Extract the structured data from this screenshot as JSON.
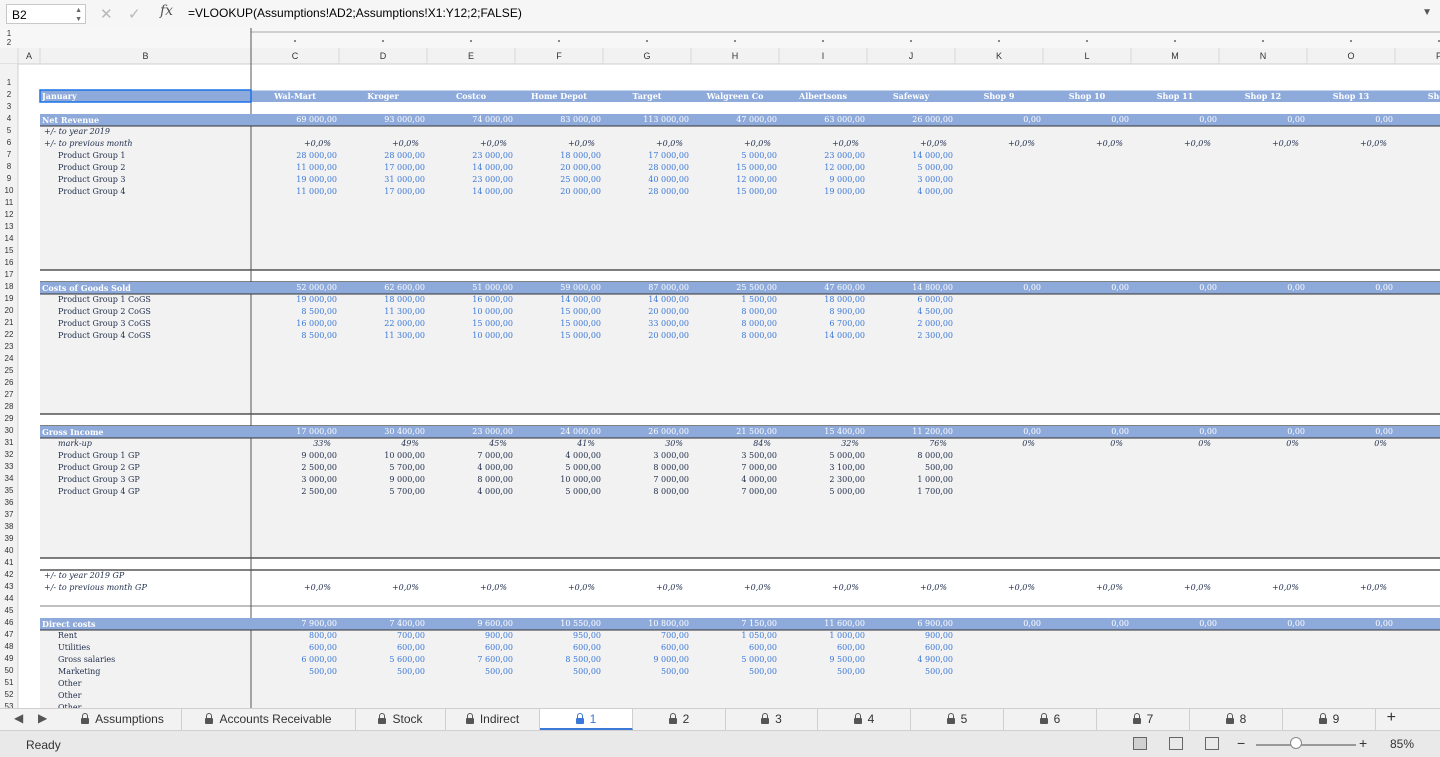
{
  "formula_bar": {
    "name_box": "B2",
    "fx": "fx",
    "formula": "=VLOOKUP(Assumptions!AD2;Assumptions!X1:Y12;2;FALSE)"
  },
  "outline_levels": [
    "1",
    "2"
  ],
  "columns": [
    "A",
    "B",
    "C",
    "D",
    "E",
    "F",
    "G",
    "H",
    "I",
    "J",
    "K",
    "L",
    "M",
    "N",
    "O",
    "P"
  ],
  "row_numbers": [
    "1",
    "2",
    "3",
    "4",
    "5",
    "6",
    "7",
    "8",
    "9",
    "10",
    "11",
    "12",
    "13",
    "14",
    "15",
    "16",
    "17",
    "18",
    "19",
    "20",
    "21",
    "22",
    "23",
    "24",
    "25",
    "26",
    "27",
    "28",
    "29",
    "30",
    "31",
    "32",
    "33",
    "34",
    "35",
    "36",
    "37",
    "38",
    "39",
    "40",
    "41",
    "42",
    "43",
    "44",
    "45",
    "46",
    "47",
    "48",
    "49",
    "50",
    "51",
    "52",
    "53"
  ],
  "header_row": {
    "label": "January",
    "shops": [
      "Wal-Mart",
      "Kroger",
      "Costco",
      "Home Depot",
      "Target",
      "Walgreen Co",
      "Albertsons",
      "Safeway",
      "Shop 9",
      "Shop 10",
      "Shop 11",
      "Shop 12",
      "Shop 13",
      "Shop"
    ]
  },
  "rows": [
    {
      "r": 4,
      "label": "Net Revenue",
      "style": "section",
      "values": [
        "69 000,00",
        "93 000,00",
        "74 000,00",
        "83 000,00",
        "113 000,00",
        "47 000,00",
        "63 000,00",
        "26 000,00",
        "0,00",
        "0,00",
        "0,00",
        "0,00",
        "0,00",
        ""
      ]
    },
    {
      "r": 5,
      "label": "+/- to year 2019",
      "style": "italic",
      "values": []
    },
    {
      "r": 6,
      "label": "+/- to previous month",
      "style": "italic",
      "values": [
        "+0,0%",
        "+0,0%",
        "+0,0%",
        "+0,0%",
        "+0,0%",
        "+0,0%",
        "+0,0%",
        "+0,0%",
        "+0,0%",
        "+0,0%",
        "+0,0%",
        "+0,0%",
        "+0,0%",
        ""
      ]
    },
    {
      "r": 7,
      "label": "Product Group 1",
      "style": "sub",
      "values": [
        "28 000,00",
        "28 000,00",
        "23 000,00",
        "18 000,00",
        "17 000,00",
        "5 000,00",
        "23 000,00",
        "14 000,00"
      ]
    },
    {
      "r": 8,
      "label": "Product Group 2",
      "style": "sub",
      "values": [
        "11 000,00",
        "17 000,00",
        "14 000,00",
        "20 000,00",
        "28 000,00",
        "15 000,00",
        "12 000,00",
        "5 000,00"
      ]
    },
    {
      "r": 9,
      "label": "Product Group 3",
      "style": "sub",
      "values": [
        "19 000,00",
        "31 000,00",
        "23 000,00",
        "25 000,00",
        "40 000,00",
        "12 000,00",
        "9 000,00",
        "3 000,00"
      ]
    },
    {
      "r": 10,
      "label": "Product Group 4",
      "style": "sub",
      "values": [
        "11 000,00",
        "17 000,00",
        "14 000,00",
        "20 000,00",
        "28 000,00",
        "15 000,00",
        "19 000,00",
        "4 000,00"
      ]
    },
    {
      "r": 18,
      "label": "Costs of Goods Sold",
      "style": "section",
      "values": [
        "52 000,00",
        "62 600,00",
        "51 000,00",
        "59 000,00",
        "87 000,00",
        "25 500,00",
        "47 600,00",
        "14 800,00",
        "0,00",
        "0,00",
        "0,00",
        "0,00",
        "0,00",
        ""
      ]
    },
    {
      "r": 19,
      "label": "Product Group 1 CoGS",
      "style": "sub",
      "values": [
        "19 000,00",
        "18 000,00",
        "16 000,00",
        "14 000,00",
        "14 000,00",
        "1 500,00",
        "18 000,00",
        "6 000,00"
      ]
    },
    {
      "r": 20,
      "label": "Product Group 2 CoGS",
      "style": "sub",
      "values": [
        "8 500,00",
        "11 300,00",
        "10 000,00",
        "15 000,00",
        "20 000,00",
        "8 000,00",
        "8 900,00",
        "4 500,00"
      ]
    },
    {
      "r": 21,
      "label": "Product Group 3 CoGS",
      "style": "sub",
      "values": [
        "16 000,00",
        "22 000,00",
        "15 000,00",
        "15 000,00",
        "33 000,00",
        "8 000,00",
        "6 700,00",
        "2 000,00"
      ]
    },
    {
      "r": 22,
      "label": "Product Group 4 CoGS",
      "style": "sub",
      "values": [
        "8 500,00",
        "11 300,00",
        "10 000,00",
        "15 000,00",
        "20 000,00",
        "8 000,00",
        "14 000,00",
        "2 300,00"
      ]
    },
    {
      "r": 30,
      "label": "Gross Income",
      "style": "section",
      "values": [
        "17 000,00",
        "30 400,00",
        "23 000,00",
        "24 000,00",
        "26 000,00",
        "21 500,00",
        "15 400,00",
        "11 200,00",
        "0,00",
        "0,00",
        "0,00",
        "0,00",
        "0,00",
        ""
      ]
    },
    {
      "r": 31,
      "label": "mark-up",
      "style": "markup",
      "values": [
        "33%",
        "49%",
        "45%",
        "41%",
        "30%",
        "84%",
        "32%",
        "76%",
        "0%",
        "0%",
        "0%",
        "0%",
        "0%",
        ""
      ]
    },
    {
      "r": 32,
      "label": "Product Group 1 GP",
      "style": "gp",
      "values": [
        "9 000,00",
        "10 000,00",
        "7 000,00",
        "4 000,00",
        "3 000,00",
        "3 500,00",
        "5 000,00",
        "8 000,00"
      ]
    },
    {
      "r": 33,
      "label": "Product Group 2 GP",
      "style": "gp",
      "values": [
        "2 500,00",
        "5 700,00",
        "4 000,00",
        "5 000,00",
        "8 000,00",
        "7 000,00",
        "3 100,00",
        "500,00"
      ]
    },
    {
      "r": 34,
      "label": "Product Group 3 GP",
      "style": "gp",
      "values": [
        "3 000,00",
        "9 000,00",
        "8 000,00",
        "10 000,00",
        "7 000,00",
        "4 000,00",
        "2 300,00",
        "1 000,00"
      ]
    },
    {
      "r": 35,
      "label": "Product Group 4 GP",
      "style": "gp",
      "values": [
        "2 500,00",
        "5 700,00",
        "4 000,00",
        "5 000,00",
        "8 000,00",
        "7 000,00",
        "5 000,00",
        "1 700,00"
      ]
    },
    {
      "r": 42,
      "label": "+/- to year 2019 GP",
      "style": "italic",
      "values": []
    },
    {
      "r": 43,
      "label": "+/- to previous month GP",
      "style": "italic",
      "values": [
        "+0,0%",
        "+0,0%",
        "+0,0%",
        "+0,0%",
        "+0,0%",
        "+0,0%",
        "+0,0%",
        "+0,0%",
        "+0,0%",
        "+0,0%",
        "+0,0%",
        "+0,0%",
        "+0,0%",
        ""
      ]
    },
    {
      "r": 46,
      "label": "Direct costs",
      "style": "section",
      "values": [
        "7 900,00",
        "7 400,00",
        "9 600,00",
        "10 550,00",
        "10 800,00",
        "7 150,00",
        "11 600,00",
        "6 900,00",
        "0,00",
        "0,00",
        "0,00",
        "0,00",
        "0,00",
        ""
      ]
    },
    {
      "r": 47,
      "label": "Rent",
      "style": "sub",
      "values": [
        "800,00",
        "700,00",
        "900,00",
        "950,00",
        "700,00",
        "1 050,00",
        "1 000,00",
        "900,00"
      ]
    },
    {
      "r": 48,
      "label": "Utilities",
      "style": "sub",
      "values": [
        "600,00",
        "600,00",
        "600,00",
        "600,00",
        "600,00",
        "600,00",
        "600,00",
        "600,00"
      ]
    },
    {
      "r": 49,
      "label": "Gross salaries",
      "style": "sub",
      "values": [
        "6 000,00",
        "5 600,00",
        "7 600,00",
        "8 500,00",
        "9 000,00",
        "5 000,00",
        "9 500,00",
        "4 900,00"
      ]
    },
    {
      "r": 50,
      "label": "Marketing",
      "style": "sub",
      "values": [
        "500,00",
        "500,00",
        "500,00",
        "500,00",
        "500,00",
        "500,00",
        "500,00",
        "500,00"
      ]
    },
    {
      "r": 51,
      "label": "Other",
      "style": "sub",
      "values": []
    },
    {
      "r": 52,
      "label": "Other",
      "style": "sub",
      "values": []
    },
    {
      "r": 53,
      "label": "Other",
      "style": "sub",
      "values": []
    }
  ],
  "sheet_tabs": [
    {
      "label": "Assumptions",
      "active": false
    },
    {
      "label": "Accounts Receivable",
      "active": false
    },
    {
      "label": "Stock",
      "active": false
    },
    {
      "label": "Indirect",
      "active": false
    },
    {
      "label": "1",
      "active": true
    },
    {
      "label": "2",
      "active": false
    },
    {
      "label": "3",
      "active": false
    },
    {
      "label": "4",
      "active": false
    },
    {
      "label": "5",
      "active": false
    },
    {
      "label": "6",
      "active": false
    },
    {
      "label": "7",
      "active": false
    },
    {
      "label": "8",
      "active": false
    },
    {
      "label": "9",
      "active": false
    }
  ],
  "add_sheet": "+",
  "status": {
    "ready": "Ready",
    "zoom": "85%",
    "zoom_minus": "−",
    "zoom_plus": "+"
  },
  "colors": {
    "section_fill": "#8eaadb",
    "label_blue": "#3c78d8",
    "gray_fill": "#f2f2f2"
  }
}
